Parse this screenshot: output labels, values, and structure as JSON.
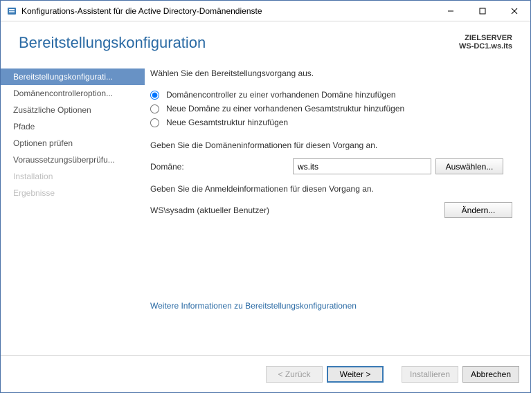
{
  "window": {
    "title": "Konfigurations-Assistent für die Active Directory-Domänendienste"
  },
  "header": {
    "title": "Bereitstellungskonfiguration",
    "target_label": "ZIELSERVER",
    "target_value": "WS-DC1.ws.its"
  },
  "sidebar": {
    "steps": [
      "Bereitstellungskonfigurati...",
      "Domänencontrolleroption...",
      "Zusätzliche Optionen",
      "Pfade",
      "Optionen prüfen",
      "Voraussetzungsüberprüfu...",
      "Installation",
      "Ergebnisse"
    ]
  },
  "content": {
    "intro": "Wählen Sie den Bereitstellungsvorgang aus.",
    "radios": {
      "opt1": "Domänencontroller zu einer vorhandenen Domäne hinzufügen",
      "opt2": "Neue Domäne zu einer vorhandenen Gesamtstruktur hinzufügen",
      "opt3": "Neue Gesamtstruktur hinzufügen",
      "selected": "opt1"
    },
    "domain_section_label": "Geben Sie die Domäneninformationen für diesen Vorgang an.",
    "domain_field_label": "Domäne:",
    "domain_value": "ws.its",
    "select_button": "Auswählen...",
    "creds_section_label": "Geben Sie die Anmeldeinformationen für diesen Vorgang an.",
    "creds_user": "WS\\sysadm (aktueller Benutzer)",
    "change_button": "Ändern...",
    "more_link": "Weitere Informationen zu Bereitstellungskonfigurationen"
  },
  "footer": {
    "back": "< Zurück",
    "next": "Weiter >",
    "install": "Installieren",
    "cancel": "Abbrechen"
  }
}
